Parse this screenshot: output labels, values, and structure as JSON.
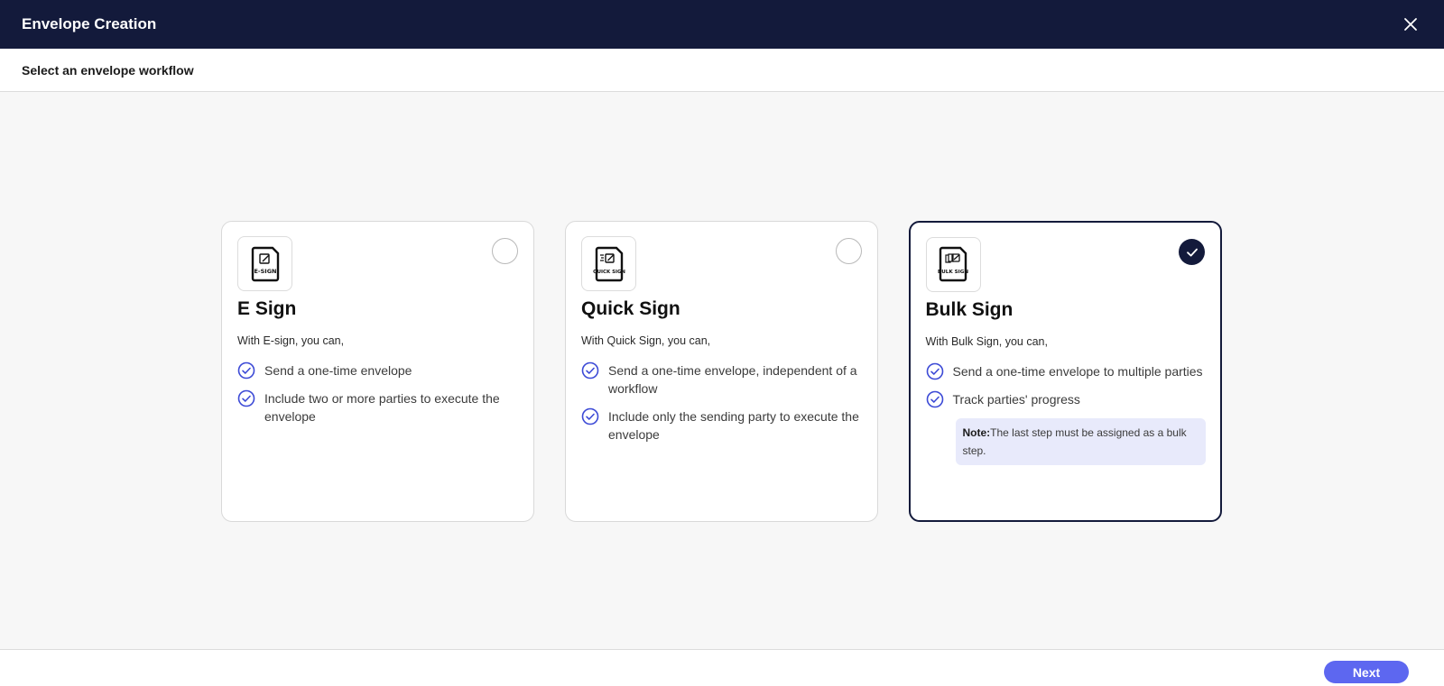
{
  "header": {
    "title": "Envelope Creation"
  },
  "subheader": {
    "title": "Select an envelope workflow"
  },
  "cards": [
    {
      "icon_label": "E-SIGN",
      "title": "E Sign",
      "intro": "With E-sign, you can,",
      "features": [
        "Send a one-time envelope",
        "Include two or more parties to execute the envelope"
      ],
      "selected": false
    },
    {
      "icon_label": "QUICK SIGN",
      "title": "Quick Sign",
      "intro": "With Quick Sign, you can,",
      "features": [
        "Send a one-time envelope, independent of a workflow",
        "Include only the sending party to execute the envelope"
      ],
      "selected": false
    },
    {
      "icon_label": "BULK SIGN",
      "title": "Bulk Sign",
      "intro": "With Bulk Sign, you can,",
      "features": [
        "Send a one-time envelope to multiple parties",
        "Track parties' progress"
      ],
      "note_label": "Note:",
      "note_text": "The last step must be assigned as a bulk step.",
      "selected": true
    }
  ],
  "footer": {
    "next_label": "Next"
  },
  "colors": {
    "header_bg": "#131a3b",
    "accent": "#5d67f0",
    "check": "#3c4ad6",
    "note_bg": "#e8eafb"
  }
}
